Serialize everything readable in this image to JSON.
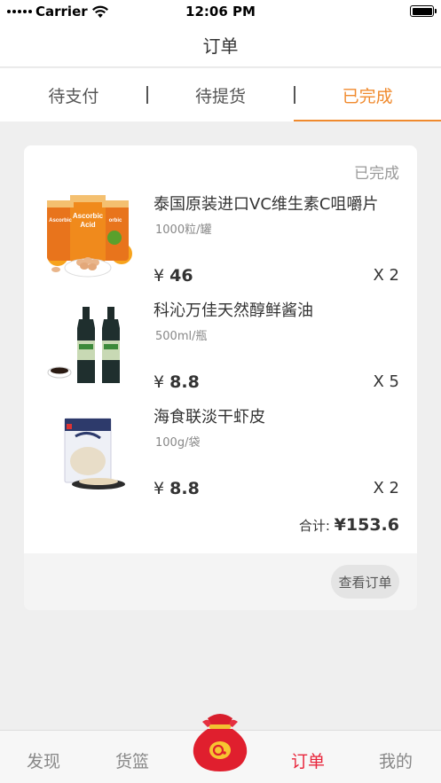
{
  "status_bar": {
    "carrier": "Carrier",
    "time": "12:06 PM"
  },
  "nav": {
    "title": "订单"
  },
  "tabs": [
    {
      "label": "待支付",
      "active": false
    },
    {
      "label": "待提货",
      "active": false
    },
    {
      "label": "已完成",
      "active": true
    }
  ],
  "order": {
    "status": "已完成",
    "items": [
      {
        "name": "泰国原装进口VC维生素C咀嚼片",
        "spec": "1000粒/罐",
        "currency": "¥",
        "price": "46",
        "qty": "X 2",
        "image": "vitamin-c-jar-image"
      },
      {
        "name": "科沁万佳天然醇鲜酱油",
        "spec": "500ml/瓶",
        "currency": "¥",
        "price": "8.8",
        "qty": "X 5",
        "image": "soy-sauce-bottles-image"
      },
      {
        "name": "海食联淡干虾皮",
        "spec": "100g/袋",
        "currency": "¥",
        "price": "8.8",
        "qty": "X 2",
        "image": "dried-shrimp-bag-image"
      }
    ],
    "total_label": "合计:",
    "total_value": "¥153.6",
    "view_button": "查看订单"
  },
  "bottom_tabs": [
    {
      "label": "发现",
      "active": false
    },
    {
      "label": "货篮",
      "active": false
    },
    {
      "label": "订单",
      "active": true
    },
    {
      "label": "我的",
      "active": false
    }
  ],
  "colors": {
    "accent": "#f08a2e",
    "tab_active": "#e8253b",
    "background": "#efefef"
  },
  "icons": [
    "wifi-icon",
    "battery-icon",
    "lucky-bag-icon"
  ]
}
